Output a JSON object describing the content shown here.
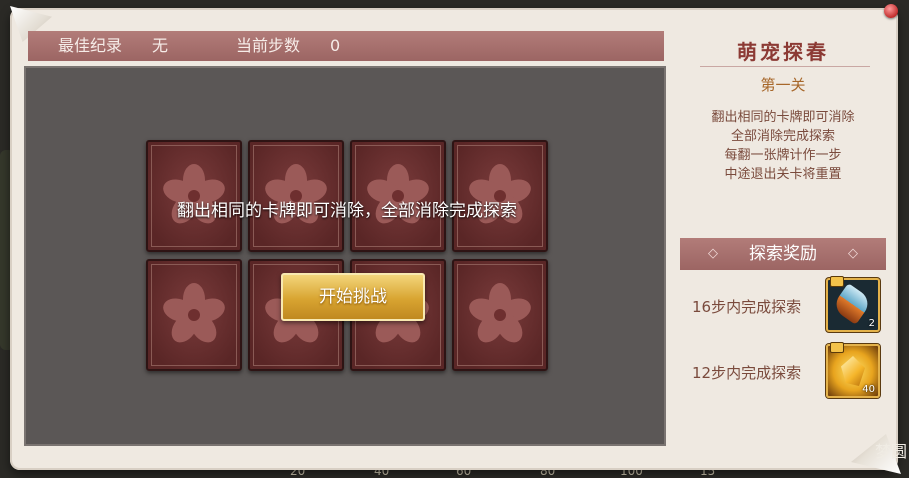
{
  "header": {
    "best_record_label": "最佳纪录",
    "best_record_value": "无",
    "current_steps_label": "当前步数",
    "current_steps_value": "0"
  },
  "board": {
    "rows": 2,
    "cols": 4,
    "card_icon": "sakura-flower-icon",
    "instruction": "翻出相同的卡牌即可消除，全部消除完成探索",
    "start_button": "开始挑战"
  },
  "side": {
    "title": "萌宠探春",
    "level": "第一关",
    "rules": [
      "翻出相同的卡牌即可消除",
      "全部消除完成探索",
      "每翻一张牌计作一步",
      "中途退出关卡将重置"
    ],
    "reward_title": "探索奖励",
    "rewards": [
      {
        "label": "16步内完成探索",
        "icon": "pendant-item-icon",
        "count": "2"
      },
      {
        "label": "12步内完成探索",
        "icon": "gold-shard-item-icon",
        "count": "40"
      }
    ]
  },
  "background": {
    "ticks": [
      "20",
      "40",
      "60",
      "80",
      "100",
      "15"
    ],
    "corner_text": "梦圆"
  },
  "colors": {
    "header_bar": "#a8706d",
    "board_bg": "#5b5756",
    "card_bg": "#6a2f2f",
    "button_gold": "#d8a431",
    "title_red": "#8c3a34"
  }
}
